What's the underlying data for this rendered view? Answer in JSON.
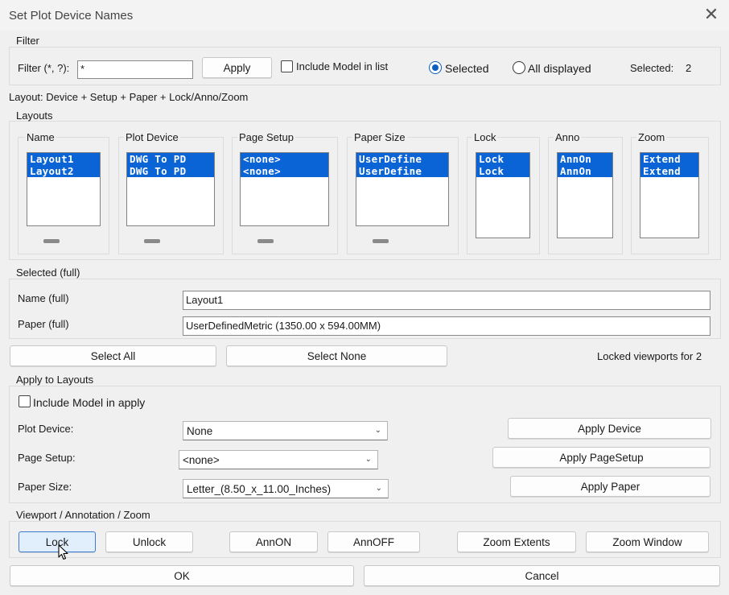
{
  "window": {
    "title": "Set Plot Device Names"
  },
  "filter": {
    "group_label": "Filter",
    "label": "Filter (*, ?):",
    "value": "*",
    "apply_label": "Apply",
    "include_model_label": "Include Model in list",
    "include_model_checked": false,
    "radio_selected_label": "Selected",
    "radio_all_label": "All displayed",
    "selected_mode": "Selected",
    "selected_count_label": "Selected:",
    "selected_count": "2"
  },
  "layout_caption": "Layout: Device + Setup + Paper + Lock/Anno/Zoom",
  "layouts": {
    "group_label": "Layouts",
    "columns": [
      {
        "header": "Name",
        "items": [
          "Layout1",
          "Layout2"
        ]
      },
      {
        "header": "Plot Device",
        "items": [
          "DWG To PD",
          "DWG To PD"
        ]
      },
      {
        "header": "Page Setup",
        "items": [
          "<none>",
          "<none>"
        ]
      },
      {
        "header": "Paper Size",
        "items": [
          "UserDefine",
          "UserDefine"
        ]
      },
      {
        "header": "Lock",
        "items": [
          "Lock",
          "Lock"
        ]
      },
      {
        "header": "Anno",
        "items": [
          "AnnOn",
          "AnnOn"
        ]
      },
      {
        "header": "Zoom",
        "items": [
          "Extend",
          "Extend"
        ]
      }
    ]
  },
  "selected_full": {
    "group_label": "Selected (full)",
    "name_label": "Name (full)",
    "name_value": "Layout1",
    "paper_label": "Paper (full)",
    "paper_value": "UserDefinedMetric (1350.00 x 594.00MM)"
  },
  "selection": {
    "select_all_label": "Select All",
    "select_none_label": "Select None",
    "status_text": "Locked viewports for 2"
  },
  "apply_to_layouts": {
    "group_label": "Apply to Layouts",
    "include_model_label": "Include Model in apply",
    "plot_device_label": "Plot Device:",
    "plot_device_value": "None",
    "page_setup_label": "Page Setup:",
    "page_setup_value": "<none>",
    "paper_size_label": "Paper Size:",
    "paper_size_value": "Letter_(8.50_x_11.00_Inches)",
    "apply_device_label": "Apply Device",
    "apply_pagesetup_label": "Apply PageSetup",
    "apply_paper_label": "Apply Paper"
  },
  "viewport": {
    "group_label": "Viewport / Annotation / Zoom",
    "lock_label": "Lock",
    "unlock_label": "Unlock",
    "annon_label": "AnnON",
    "annoff_label": "AnnOFF",
    "zoom_extents_label": "Zoom Extents",
    "zoom_window_label": "Zoom Window"
  },
  "footer": {
    "ok_label": "OK",
    "cancel_label": "Cancel"
  },
  "icons": {
    "close": "close-icon",
    "chevron": "chevron-down-icon",
    "cursor": "mouse-pointer-icon"
  },
  "colors": {
    "selection": "#0a64d6",
    "radio_accent": "#0a5fc5",
    "background": "#f0f0f0"
  }
}
